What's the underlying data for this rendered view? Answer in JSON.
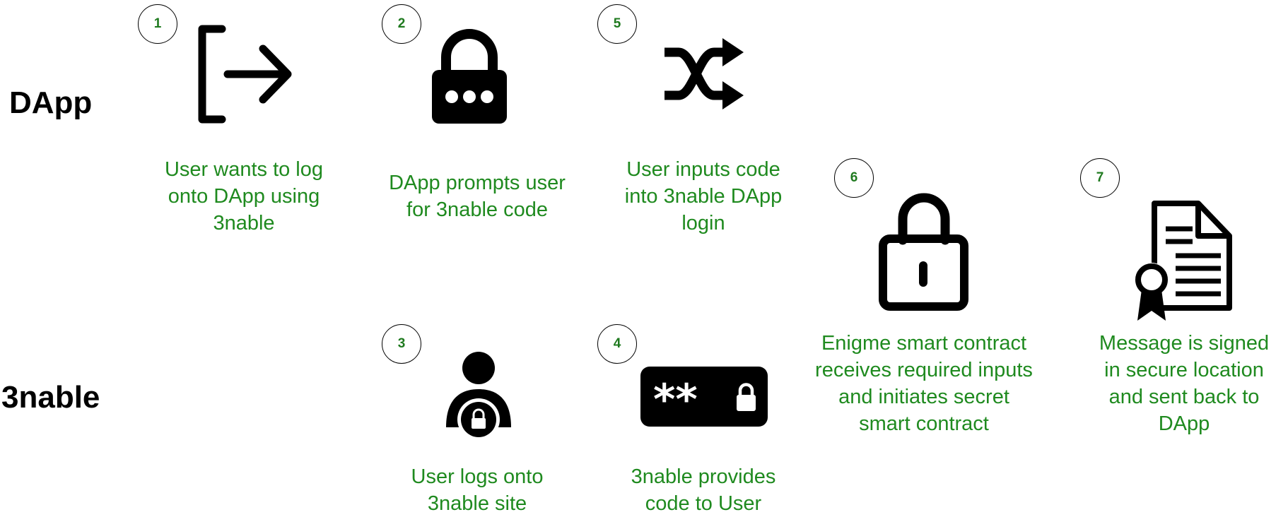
{
  "lanes": {
    "dapp": "DApp",
    "threenable": "3nable"
  },
  "steps": {
    "s1": {
      "number": "1",
      "icon": "logout-arrow-icon",
      "lines": [
        "User wants to log",
        "onto DApp using",
        "3nable"
      ]
    },
    "s2": {
      "number": "2",
      "icon": "lock-password-icon",
      "lines": [
        "DApp prompts user",
        "for 3nable code"
      ]
    },
    "s3": {
      "number": "3",
      "icon": "user-lock-icon",
      "lines": [
        "User logs onto",
        "3nable site"
      ]
    },
    "s4": {
      "number": "4",
      "icon": "password-field-icon",
      "symbol": "**",
      "lines": [
        "3nable provides",
        "code to User"
      ]
    },
    "s5": {
      "number": "5",
      "icon": "shuffle-icon",
      "lines": [
        "User inputs code",
        "into 3nable DApp",
        "login"
      ]
    },
    "s6": {
      "number": "6",
      "icon": "unlock-icon",
      "lines": [
        "Enigme smart contract",
        "receives required inputs",
        "and initiates secret",
        "smart contract"
      ]
    },
    "s7": {
      "number": "7",
      "icon": "certificate-document-icon",
      "lines": [
        "Message is signed",
        "in secure location",
        "and sent back to",
        "DApp"
      ]
    }
  },
  "colors": {
    "caption": "#1f8a1f",
    "badge_text": "#1f7a1f",
    "icon": "#000000"
  }
}
